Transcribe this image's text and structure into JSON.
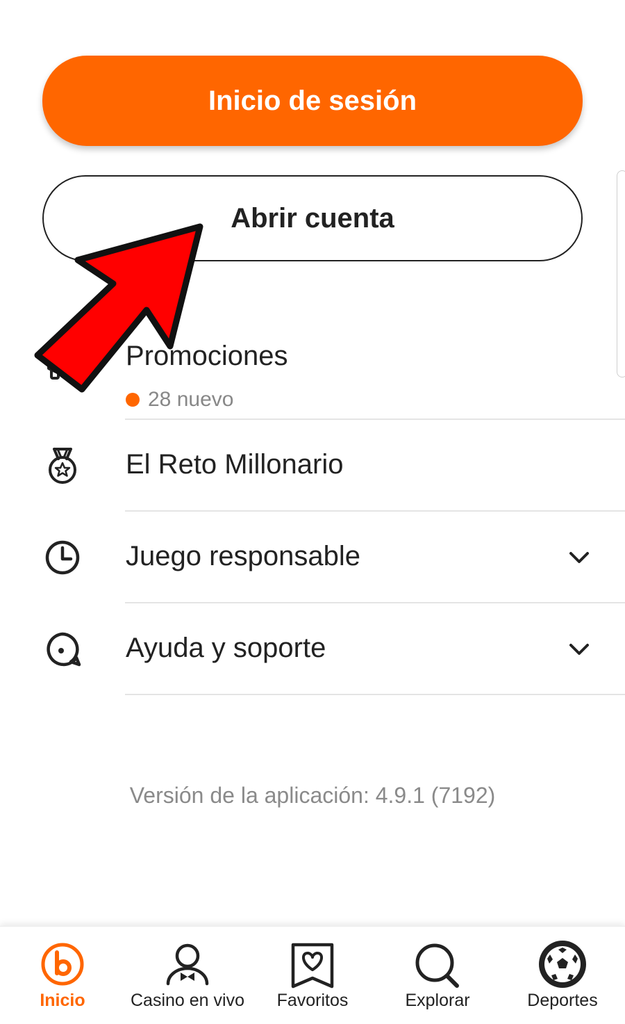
{
  "auth": {
    "login_label": "Inicio de sesión",
    "register_label": "Abrir cuenta"
  },
  "menu": {
    "promotions": {
      "label": "Promociones",
      "badge_count": "28 nuevo",
      "badge_color": "#ff6600"
    },
    "items": [
      {
        "label": "El Reto Millonario",
        "icon": "medal-icon"
      },
      {
        "label": "Juego responsable",
        "icon": "clock-icon",
        "expandable": true
      },
      {
        "label": "Ayuda y soporte",
        "icon": "chat-icon",
        "expandable": true
      }
    ]
  },
  "footer": {
    "version": "Versión de la aplicación: 4.9.1 (7192)"
  },
  "bottom_nav": {
    "items": [
      {
        "label": "Inicio",
        "icon": "home-logo-icon",
        "active": true
      },
      {
        "label": "Casino en vivo",
        "icon": "dealer-icon"
      },
      {
        "label": "Favoritos",
        "icon": "favorites-icon"
      },
      {
        "label": "Explorar",
        "icon": "search-icon"
      },
      {
        "label": "Deportes",
        "icon": "soccer-ball-icon"
      }
    ]
  },
  "colors": {
    "accent": "#ff6600",
    "annotation_arrow": "#ff0000",
    "text": "#222222",
    "muted": "#888888"
  }
}
